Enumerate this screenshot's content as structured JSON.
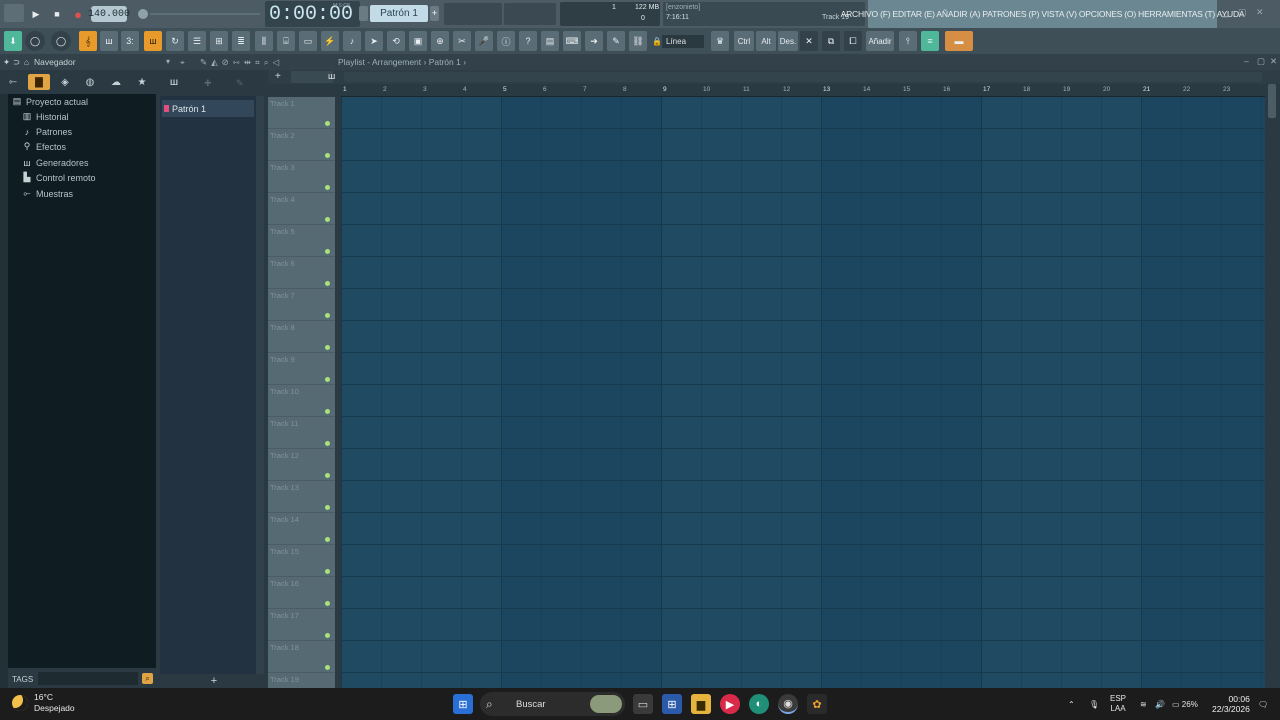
{
  "topbar": {
    "tempo": "140.000",
    "time": "0:00:00",
    "time_small": "M:S:CS",
    "pattern": "Patrón 1",
    "cpu": "1",
    "memory": "122 MB",
    "voices": "0",
    "hint_user": "[enzonieto]",
    "hint_time": "7:16:11",
    "track_label": "Track 19",
    "menu": "ARCHIVO (F)  EDITAR (E)  AÑADIR (A)  PATRONES (P)  VISTA (V)  OPCIONES (O)  HERRAMIENTAS (T)  AYUDA"
  },
  "toolbar": {
    "snap_value": "Línea",
    "ctrl_label": "Ctrl",
    "alt_label": "Alt",
    "des_label": "Des.",
    "add_label": "Añadir"
  },
  "navigator": {
    "title": "Navegador",
    "items": [
      {
        "label": "Proyecto actual",
        "icon": "folder-icon"
      },
      {
        "label": "Historial",
        "icon": "history-icon"
      },
      {
        "label": "Patrones",
        "icon": "note-icon"
      },
      {
        "label": "Efectos",
        "icon": "effects-icon"
      },
      {
        "label": "Generadores",
        "icon": "keyboard-icon"
      },
      {
        "label": "Control remoto",
        "icon": "remote-icon"
      },
      {
        "label": "Muestras",
        "icon": "samples-icon"
      }
    ],
    "tags_label": "TAGS"
  },
  "picker": {
    "pattern_item": "Patrón 1"
  },
  "playlist": {
    "title": "Playlist - Arrangement › Patrón 1 ›",
    "bar_numbers": [
      "1",
      "2",
      "3",
      "4",
      "5",
      "6",
      "7",
      "8",
      "9",
      "10",
      "11",
      "12",
      "13",
      "14",
      "15",
      "16",
      "17",
      "18",
      "19",
      "20",
      "21",
      "22",
      "23"
    ],
    "tracks": [
      "Track 1",
      "Track 2",
      "Track 3",
      "Track 4",
      "Track 5",
      "Track 6",
      "Track 7",
      "Track 8",
      "Track 9",
      "Track 10",
      "Track 11",
      "Track 12",
      "Track 13",
      "Track 14",
      "Track 15",
      "Track 16",
      "Track 17",
      "Track 18",
      "Track 19"
    ]
  },
  "taskbar": {
    "temperature": "16°C",
    "weather": "Despejado",
    "search_placeholder": "Buscar",
    "lang_top": "ESP",
    "lang_bottom": "LAA",
    "battery": "26%",
    "time": "00:06",
    "date": "22/3/2026"
  },
  "colors": {
    "menu_bg": "#6b8792",
    "grid_bg": "#1f4a62",
    "accent_orange": "#e89a2a",
    "led_green": "#a8e07a"
  }
}
